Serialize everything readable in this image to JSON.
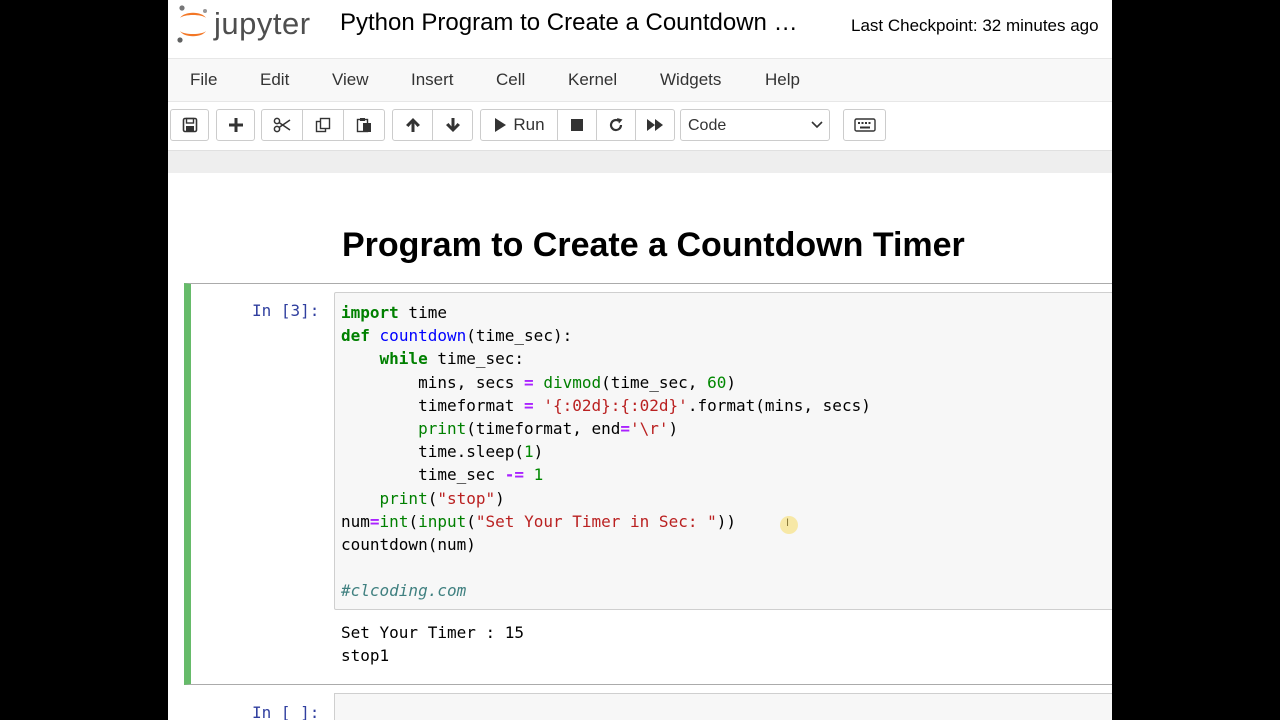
{
  "header": {
    "logo_text": "jupyter",
    "notebook_title": "Python Program to Create a Countdown …",
    "checkpoint": "Last Checkpoint: 32 minutes ago"
  },
  "menu": [
    "File",
    "Edit",
    "View",
    "Insert",
    "Cell",
    "Kernel",
    "Widgets",
    "Help"
  ],
  "toolbar": {
    "run_label": "Run",
    "cell_type": "Code",
    "icons": [
      "save-icon",
      "plus-icon",
      "cut-icon",
      "copy-icon",
      "paste-icon",
      "arrow-up-icon",
      "arrow-down-icon",
      "run-icon",
      "stop-icon",
      "restart-icon",
      "fast-forward-icon",
      "keyboard-icon"
    ]
  },
  "notebook": {
    "heading": "Program to Create a Countdown Timer",
    "cell1": {
      "prompt": "In [3]:",
      "code_lines": [
        "import time",
        "def countdown(time_sec):",
        "    while time_sec:",
        "        mins, secs = divmod(time_sec, 60)",
        "        timeformat = '{:02d}:{:02d}'.format(mins, secs)",
        "        print(timeformat, end='\\r')",
        "        time.sleep(1)",
        "        time_sec -= 1",
        "    print(\"stop\")",
        "num=int(input(\"Set Your Timer in Sec: \"))",
        "countdown(num)",
        "",
        "#clcoding.com"
      ],
      "output_lines": [
        "Set Your Timer : 15",
        "stop1"
      ]
    },
    "cell2": {
      "prompt": "In [ ]:"
    },
    "cursor_glyph": "I"
  },
  "colors": {
    "active_cell_border": "#66bb6a",
    "prompt": "#303f9f",
    "logo_orange": "#f37726"
  }
}
